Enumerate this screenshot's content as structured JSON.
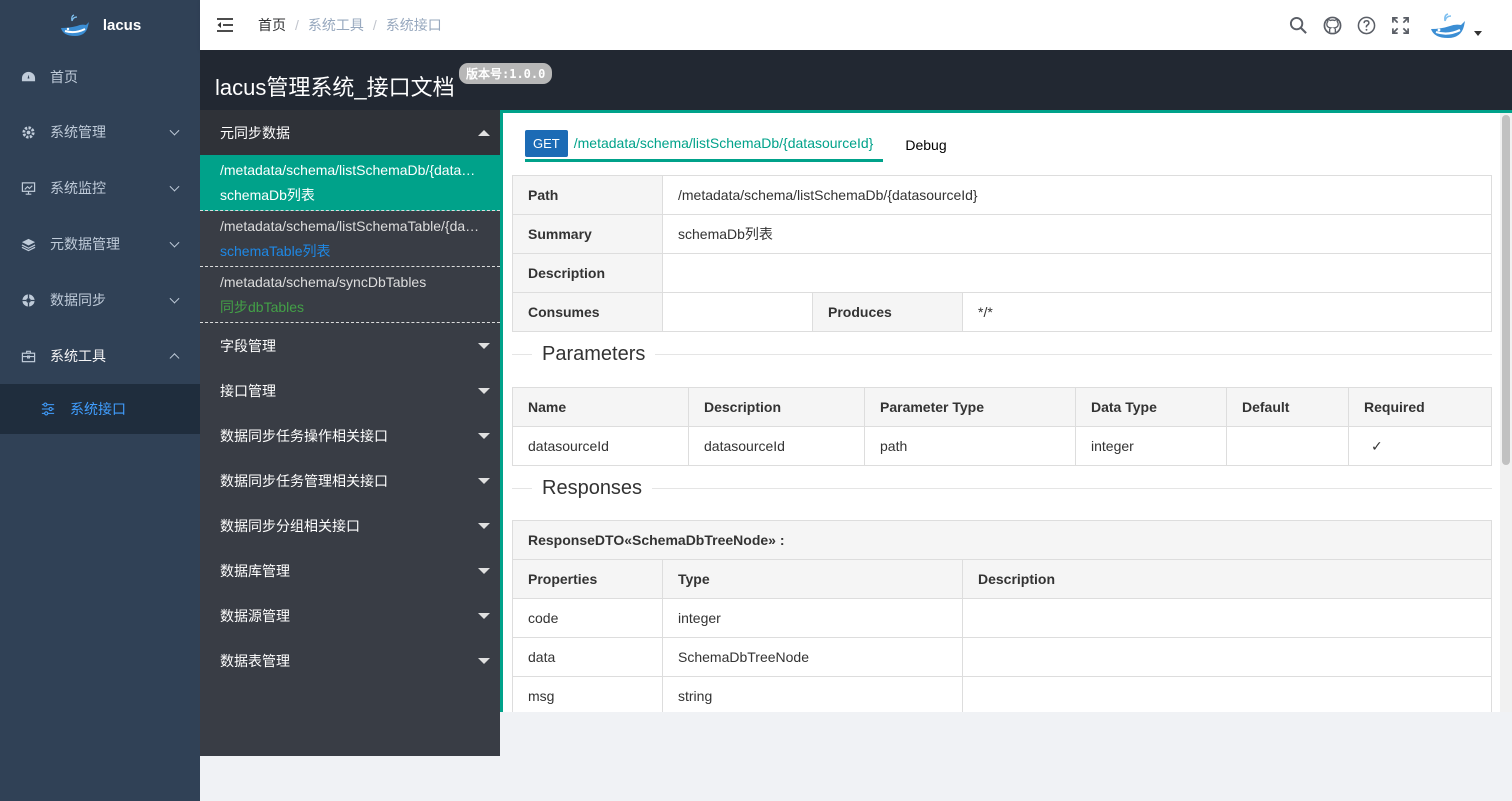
{
  "app": {
    "brand": "lacus",
    "menu": [
      {
        "label": "首页",
        "icon": "dashboard-icon"
      },
      {
        "label": "系统管理",
        "icon": "gear-icon"
      },
      {
        "label": "系统监控",
        "icon": "monitor-icon"
      },
      {
        "label": "元数据管理",
        "icon": "layers-icon"
      },
      {
        "label": "数据同步",
        "icon": "sync-icon"
      },
      {
        "label": "系统工具",
        "icon": "toolbox-icon"
      }
    ],
    "submenu": [
      {
        "label": "系统接口",
        "icon": "sliders-icon"
      }
    ]
  },
  "breadcrumb": [
    "首页",
    "系统工具",
    "系统接口"
  ],
  "doc": {
    "title": "lacus管理系统_接口文档",
    "version": "版本号:1.0.0"
  },
  "api_nav": {
    "open_group": "元同步数据",
    "items": [
      {
        "path": "/metadata/schema/listSchemaDb/{datasourceId}",
        "summary": "schemaDb列表"
      },
      {
        "path": "/metadata/schema/listSchemaTable/{datasourceId}",
        "summary": "schemaTable列表"
      },
      {
        "path": "/metadata/schema/syncDbTables",
        "summary": "同步dbTables"
      }
    ],
    "groups": [
      "字段管理",
      "接口管理",
      "数据同步任务操作相关接口",
      "数据同步任务管理相关接口",
      "数据同步分组相关接口",
      "数据库管理",
      "数据源管理",
      "数据表管理"
    ]
  },
  "content": {
    "method": "GET",
    "path": "/metadata/schema/listSchemaDb/{datasourceId}",
    "debug_tab": "Debug",
    "info": {
      "path_label": "Path",
      "path_value": "/metadata/schema/listSchemaDb/{datasourceId}",
      "summary_label": "Summary",
      "summary_value": "schemaDb列表",
      "description_label": "Description",
      "description_value": "",
      "consumes_label": "Consumes",
      "consumes_value": "",
      "produces_label": "Produces",
      "produces_value": "*/*"
    },
    "parameters_title": "Parameters",
    "param_headers": [
      "Name",
      "Description",
      "Parameter Type",
      "Data Type",
      "Default",
      "Required"
    ],
    "param_rows": [
      [
        "datasourceId",
        "datasourceId",
        "path",
        "integer",
        "",
        "✓"
      ]
    ],
    "responses_title": "Responses",
    "response_dto": "ResponseDTO«SchemaDbTreeNode» :",
    "resp_headers": [
      "Properties",
      "Type",
      "Description"
    ],
    "resp_rows": [
      [
        "code",
        "integer",
        ""
      ],
      [
        "data",
        "SchemaDbTreeNode",
        ""
      ],
      [
        "msg",
        "string",
        ""
      ]
    ]
  },
  "colors": {
    "accent": "#00a28a",
    "method": "#1c6bb5",
    "sidebar": "#304156",
    "active_sub": "#409eff"
  }
}
